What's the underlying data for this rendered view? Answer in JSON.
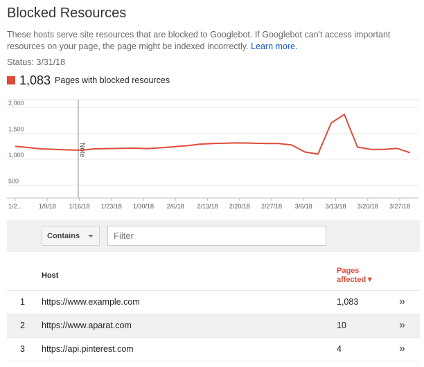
{
  "header": {
    "title": "Blocked Resources",
    "description": "These hosts serve site resources that are blocked to Googlebot. If Googlebot can't access important resources on your page, the page might be indexed incorrectly.",
    "learn_more": "Learn more.",
    "status": "Status: 3/31/18"
  },
  "metric": {
    "count": "1,083",
    "label": "Pages with blocked resources",
    "color": "#dd4b39"
  },
  "chart_data": {
    "type": "line",
    "x": [
      "1/2...",
      "1/9/18",
      "1/16/18",
      "1/23/18",
      "1/30/18",
      "2/6/18",
      "2/13/18",
      "2/20/18",
      "2/27/18",
      "3/6/18",
      "3/13/18",
      "3/20/18",
      "3/27/18"
    ],
    "y_ticks": [
      "2,000",
      "1,500",
      "1,000",
      "500"
    ],
    "ylim": [
      250,
      2150
    ],
    "annotation": {
      "label": "Note",
      "x": "1/16/18"
    },
    "series": [
      {
        "color": "#dd4b39",
        "points": [
          [
            0,
            1250
          ],
          [
            1,
            1225
          ],
          [
            2,
            1200
          ],
          [
            3,
            1190
          ],
          [
            4,
            1180
          ],
          [
            5,
            1175
          ],
          [
            6,
            1200
          ],
          [
            7,
            1205
          ],
          [
            8,
            1210
          ],
          [
            9,
            1215
          ],
          [
            10,
            1205
          ],
          [
            11,
            1220
          ],
          [
            12,
            1240
          ],
          [
            13,
            1260
          ],
          [
            14,
            1290
          ],
          [
            15,
            1305
          ],
          [
            16,
            1310
          ],
          [
            17,
            1315
          ],
          [
            18,
            1310
          ],
          [
            19,
            1305
          ],
          [
            20,
            1305
          ],
          [
            21,
            1275
          ],
          [
            22,
            1140
          ],
          [
            23,
            1100
          ],
          [
            24,
            1700
          ],
          [
            25,
            1865
          ],
          [
            26,
            1235
          ],
          [
            27,
            1190
          ],
          [
            28,
            1190
          ],
          [
            29,
            1210
          ],
          [
            30,
            1125
          ]
        ]
      }
    ],
    "grid": true
  },
  "filter": {
    "dropdown_label": "Contains",
    "placeholder": "Filter"
  },
  "table": {
    "col_host": "Host",
    "col_pages": "Pages affected",
    "sort_indicator": "▼",
    "rows": [
      {
        "idx": "1",
        "host": "https://www.example.com",
        "pages": "1,083"
      },
      {
        "idx": "2",
        "host": "https://www.aparat.com",
        "pages": "10"
      },
      {
        "idx": "3",
        "host": "https://api.pinterest.com",
        "pages": "4"
      }
    ],
    "row_action": "»"
  }
}
